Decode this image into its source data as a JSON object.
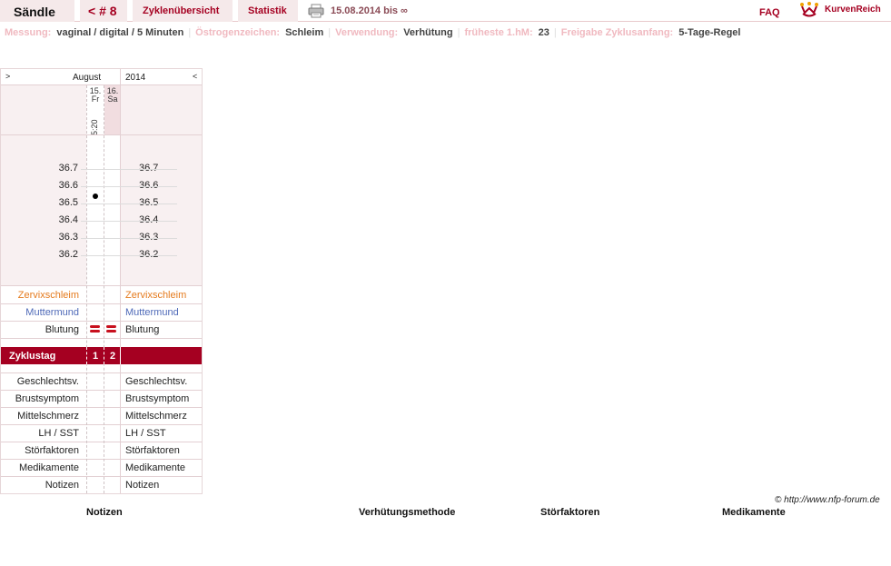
{
  "header": {
    "user": "Sändle",
    "cycle_nav": "< # 8",
    "tabs": [
      "Zyklenübersicht",
      "Statistik"
    ],
    "date_range": "15.08.2014 bis ∞",
    "faq": "FAQ",
    "logo_text": "KurvenReich",
    "icons": {
      "print": "printer-icon",
      "logo": "kurvenreich-crown-icon"
    }
  },
  "info": {
    "measurement_label": "Messung:",
    "measurement_value": "vaginal / digital / 5 Minuten",
    "estrogen_label": "Östrogenzeichen:",
    "estrogen_value": "Schleim",
    "usage_label": "Verwendung:",
    "usage_value": "Verhütung",
    "earliest_label": "früheste 1.hM:",
    "earliest_value": "23",
    "release_label": "Freigabe Zyklusanfang:",
    "release_value": "5-Tage-Regel"
  },
  "chart": {
    "nav_prev": ">",
    "nav_next": "<",
    "month": "August",
    "year": "2014",
    "days": [
      {
        "date": "15.",
        "weekday": "Fr",
        "time": "5:20",
        "selected": false
      },
      {
        "date": "16.",
        "weekday": "Sa",
        "time": "",
        "selected": true
      }
    ],
    "temp_axis_left": [
      "36.7",
      "36.6",
      "36.5",
      "36.4",
      "36.3",
      "36.2"
    ],
    "temp_axis_right": [
      "36.7",
      "36.6",
      "36.5",
      "36.4",
      "36.3",
      "36.2"
    ],
    "temperature_readings": [
      {
        "day_index": 0,
        "value": 36.54
      }
    ],
    "cervix_mucus": "Zervixschleim",
    "cervix": "Muttermund",
    "bleeding": "Blutung",
    "bleeding_days": [
      0,
      1
    ],
    "cycle_day_label": "Zyklustag",
    "cycle_days": [
      "1",
      "2"
    ],
    "rows": [
      "Geschlechtsv.",
      "Brustsymptom",
      "Mittelschmerz",
      "LH / SST",
      "Störfaktoren",
      "Medikamente",
      "Notizen"
    ],
    "colors": {
      "accent": "#a50021",
      "mucus": "#e57b1e",
      "cervix": "#4f6ab8",
      "bleeding": "#c8101e"
    }
  },
  "footer": {
    "copyright": "© http://www.nfp-forum.de",
    "headings": [
      "Notizen",
      "Verhütungsmethode",
      "Störfaktoren",
      "Medikamente"
    ]
  }
}
